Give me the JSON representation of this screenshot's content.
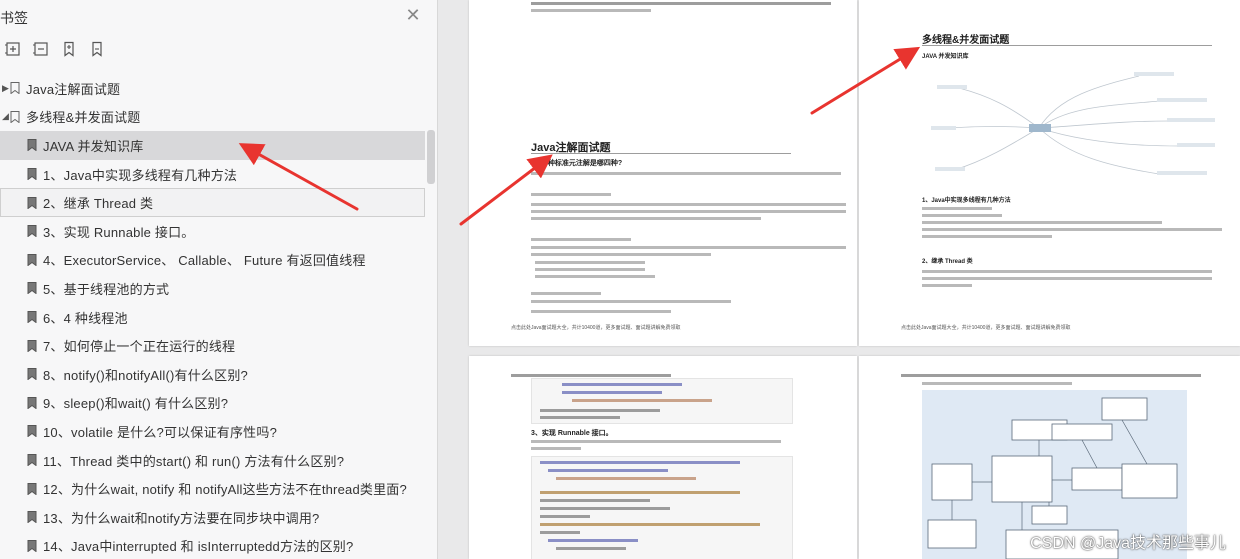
{
  "panel": {
    "title": "书签",
    "close_glyph": "✕",
    "tools": [
      "expand-all-icon",
      "collapse-all-icon",
      "add-bookmark-icon",
      "bookmark-icon"
    ],
    "items": [
      {
        "label": "Java注解面试题",
        "level": 1,
        "expanded": false
      },
      {
        "label": "多线程&并发面试题",
        "level": 1,
        "expanded": true
      },
      {
        "label": "JAVA 并发知识库",
        "level": 2,
        "selected": true
      },
      {
        "label": "1、Java中实现多线程有几种方法",
        "level": 2
      },
      {
        "label": "2、继承 Thread 类",
        "level": 2,
        "hover": true
      },
      {
        "label": "3、实现 Runnable 接口。",
        "level": 2
      },
      {
        "label": "4、ExecutorService、 Callable、 Future 有返回值线程",
        "level": 2
      },
      {
        "label": "5、基于线程池的方式",
        "level": 2
      },
      {
        "label": "6、4 种线程池",
        "level": 2
      },
      {
        "label": "7、如何停止一个正在运行的线程",
        "level": 2
      },
      {
        "label": "8、notify()和notifyAll()有什么区别?",
        "level": 2
      },
      {
        "label": "9、sleep()和wait() 有什么区别?",
        "level": 2
      },
      {
        "label": "10、volatile 是什么?可以保证有序性吗?",
        "level": 2
      },
      {
        "label": "11、Thread 类中的start() 和 run() 方法有什么区别?",
        "level": 2
      },
      {
        "label": "12、为什么wait, notify 和 notifyAll这些方法不在thread类里面?",
        "level": 2
      },
      {
        "label": "13、为什么wait和notify方法要在同步块中调用?",
        "level": 2
      },
      {
        "label": "14、Java中interrupted 和 isInterruptedd方法的区别?",
        "level": 2
      }
    ]
  },
  "pages": {
    "p1": {
      "heading": "Java注解面试题",
      "subheading": "4种标准元注解是哪四种?",
      "footer": "点击此处Java面试题大全，共计10400道，更多面试题、面试题讲解免费领取"
    },
    "p2": {
      "heading": "多线程&并发面试题",
      "subheading": "JAVA 并发知识库",
      "section1": "1、Java中实现多线程有几种方法",
      "section2": "2、继承 Thread 类",
      "footer": "点击此处Java面试题大全，共计10400道，更多面试题、面试题讲解免费领取"
    },
    "p3": {
      "section": "3、实现 Runnable 接口。"
    }
  },
  "watermark": "CSDN @Java技术那些事儿"
}
